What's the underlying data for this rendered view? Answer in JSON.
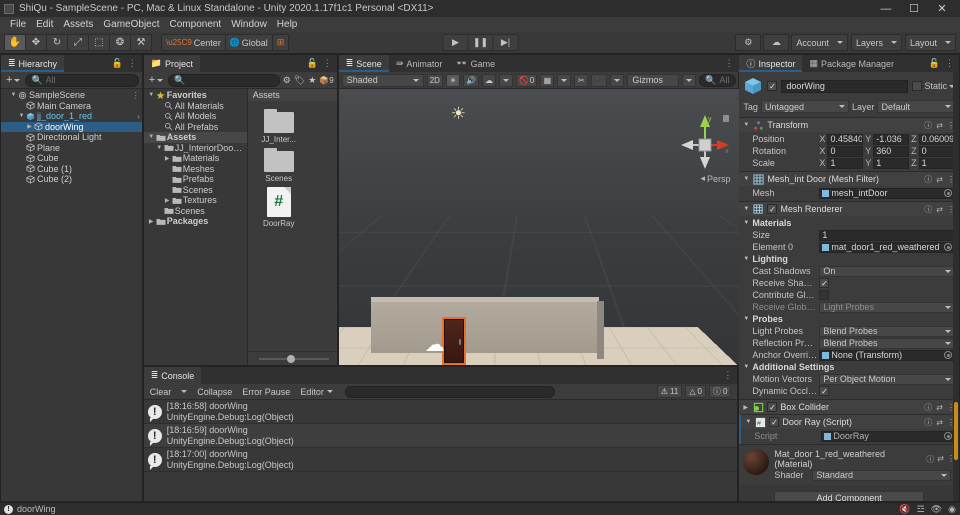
{
  "window": {
    "title": "ShiQu - SampleScene - PC, Mac & Linux Standalone - Unity 2020.1.17f1c1 Personal <DX11>",
    "minimize": "—",
    "maximize": "☐",
    "close": "✕"
  },
  "menu": {
    "items": [
      "File",
      "Edit",
      "Assets",
      "GameObject",
      "Component",
      "Window",
      "Help"
    ]
  },
  "toolbar": {
    "tools": [
      {
        "name": "hand-tool",
        "glyph": "✋",
        "active": true
      },
      {
        "name": "move-tool",
        "glyph": "✥",
        "active": false
      },
      {
        "name": "rotate-tool",
        "glyph": "↻",
        "active": false
      },
      {
        "name": "scale-tool",
        "glyph": "⤢",
        "active": false
      },
      {
        "name": "rect-tool",
        "glyph": "⬚",
        "active": false
      },
      {
        "name": "transform-tool",
        "glyph": "❂",
        "active": false
      },
      {
        "name": "custom-tool",
        "glyph": "⚒",
        "active": false
      }
    ],
    "pivot_label": "Center",
    "space_label": "Global",
    "grid_snap_glyph": "⊞",
    "play": "▶",
    "pause": "❚❚",
    "step": "▶|",
    "collab_label": "⚙",
    "cloud_label": "☁",
    "account_label": "Account",
    "layers_label": "Layers",
    "layout_label": "Layout"
  },
  "hierarchy": {
    "tab_label": "Hierarchy",
    "search_placeholder": "All",
    "add_label": "+",
    "items": [
      {
        "label": "SampleScene",
        "depth": 0,
        "arrow": "▼",
        "icon": "scene-icon",
        "selected": false,
        "menu": "⋮"
      },
      {
        "label": "Main Camera",
        "depth": 1,
        "arrow": "",
        "icon": "gameobject-icon",
        "selected": false
      },
      {
        "label": "jj_door_1_red",
        "depth": 1,
        "arrow": "▼",
        "icon": "prefab-icon",
        "selected": false,
        "chevron": "›"
      },
      {
        "label": "doorWing",
        "depth": 2,
        "arrow": "▶",
        "icon": "gameobject-icon",
        "selected": true
      },
      {
        "label": "Directional Light",
        "depth": 1,
        "arrow": "",
        "icon": "gameobject-icon",
        "selected": false
      },
      {
        "label": "Plane",
        "depth": 1,
        "arrow": "",
        "icon": "gameobject-icon",
        "selected": false
      },
      {
        "label": "Cube",
        "depth": 1,
        "arrow": "",
        "icon": "gameobject-icon",
        "selected": false
      },
      {
        "label": "Cube (1)",
        "depth": 1,
        "arrow": "",
        "icon": "gameobject-icon",
        "selected": false
      },
      {
        "label": "Cube (2)",
        "depth": 1,
        "arrow": "",
        "icon": "gameobject-icon",
        "selected": false
      }
    ]
  },
  "project": {
    "tab_label": "Project",
    "search_placeholder": "",
    "badge_count": "9",
    "tree": [
      {
        "label": "Favorites",
        "depth": 0,
        "arrow": "▼",
        "icon": "star-icon"
      },
      {
        "label": "All Materials",
        "depth": 1,
        "arrow": "",
        "icon": "search-icon"
      },
      {
        "label": "All Models",
        "depth": 1,
        "arrow": "",
        "icon": "search-icon"
      },
      {
        "label": "All Prefabs",
        "depth": 1,
        "arrow": "",
        "icon": "search-icon"
      },
      {
        "label": "Assets",
        "depth": 0,
        "arrow": "▼",
        "icon": "folder-icon",
        "highlighted": true
      },
      {
        "label": "JJ_InteriorDoorPack_",
        "depth": 1,
        "arrow": "▼",
        "icon": "folder-icon"
      },
      {
        "label": "Materials",
        "depth": 2,
        "arrow": "▶",
        "icon": "folder-icon"
      },
      {
        "label": "Meshes",
        "depth": 2,
        "arrow": "",
        "icon": "folder-icon"
      },
      {
        "label": "Prefabs",
        "depth": 2,
        "arrow": "",
        "icon": "folder-icon"
      },
      {
        "label": "Scenes",
        "depth": 2,
        "arrow": "",
        "icon": "folder-icon"
      },
      {
        "label": "Textures",
        "depth": 2,
        "arrow": "▶",
        "icon": "folder-icon"
      },
      {
        "label": "Scenes",
        "depth": 1,
        "arrow": "",
        "icon": "folder-icon"
      },
      {
        "label": "Packages",
        "depth": 0,
        "arrow": "▶",
        "icon": "folder-icon"
      }
    ],
    "grid_header": "Assets",
    "assets": [
      {
        "label": "JJ_Inter...",
        "type": "folder"
      },
      {
        "label": "Scenes",
        "type": "folder"
      },
      {
        "label": "DoorRay",
        "type": "csharp-script"
      }
    ]
  },
  "scene": {
    "tabs": [
      {
        "label": "Scene",
        "icon": "scene-icon",
        "selected": true
      },
      {
        "label": "Animator",
        "icon": "animator-icon",
        "selected": false
      },
      {
        "label": "Game",
        "icon": "game-icon",
        "selected": false
      }
    ],
    "shading_mode": "Shaded",
    "mode_2d": "2D",
    "lighting_glyph": "☀",
    "audio_glyph": "ᴘ",
    "fx_glyph": "☁",
    "hidden_count": "0",
    "gizmos_label": "Gizmos",
    "search_placeholder": "All",
    "projection_label": "Persp",
    "gizmo_axis_x": "x",
    "gizmo_axis_y": "y"
  },
  "console": {
    "tab_label": "Console",
    "clear_label": "Clear",
    "collapse_label": "Collapse",
    "error_pause_label": "Error Pause",
    "editor_label": "Editor",
    "error_count": "11",
    "warning_count": "0",
    "info_count": "0",
    "logs": [
      {
        "line1": "[18:16:58] doorWing",
        "line2": "UnityEngine.Debug:Log(Object)"
      },
      {
        "line1": "[18:16:59] doorWing",
        "line2": "UnityEngine.Debug:Log(Object)"
      },
      {
        "line1": "[18:17:00] doorWing",
        "line2": "UnityEngine.Debug:Log(Object)"
      }
    ]
  },
  "inspector": {
    "tabs": [
      {
        "label": "Inspector",
        "icon": "info-icon",
        "selected": true
      },
      {
        "label": "Package Manager",
        "icon": "package-icon",
        "selected": false
      }
    ],
    "gameobject": {
      "name": "doorWing",
      "enabled": true,
      "static_label": "Static",
      "tag_label": "Tag",
      "tag_value": "Untagged",
      "layer_label": "Layer",
      "layer_value": "Default"
    },
    "components": [
      {
        "title": "Transform",
        "icon": "transform-icon",
        "rows": [
          {
            "label": "Position",
            "type": "vec3",
            "x": "0.45840",
            "y": "-1.036",
            "z": "0.060098"
          },
          {
            "label": "Rotation",
            "type": "vec3",
            "x": "0",
            "y": "360",
            "z": "0"
          },
          {
            "label": "Scale",
            "type": "vec3",
            "x": "1",
            "y": "1",
            "z": "1"
          }
        ]
      },
      {
        "title": "Mesh_int Door (Mesh Filter)",
        "icon": "meshfilter-icon",
        "rows": [
          {
            "label": "Mesh",
            "type": "object",
            "value": "mesh_intDoor"
          }
        ]
      },
      {
        "title": "Mesh Renderer",
        "icon": "meshrenderer-icon",
        "checkbox": true,
        "rows": [
          {
            "label": "Materials",
            "type": "section"
          },
          {
            "label": "Size",
            "type": "text",
            "value": "1"
          },
          {
            "label": "Element 0",
            "type": "object",
            "value": "mat_door1_red_weathered"
          },
          {
            "label": "Lighting",
            "type": "section"
          },
          {
            "label": "Cast Shadows",
            "type": "select",
            "value": "On"
          },
          {
            "label": "Receive Shadows",
            "type": "check",
            "value": true
          },
          {
            "label": "Contribute Global",
            "type": "check",
            "value": false
          },
          {
            "label": "Receive Global Illu",
            "type": "select",
            "value": "Light Probes",
            "dim": true
          },
          {
            "label": "Probes",
            "type": "section"
          },
          {
            "label": "Light Probes",
            "type": "select",
            "value": "Blend Probes"
          },
          {
            "label": "Reflection Probes",
            "type": "select",
            "value": "Blend Probes"
          },
          {
            "label": "Anchor Override",
            "type": "object",
            "value": "None (Transform)"
          },
          {
            "label": "Additional Settings",
            "type": "section"
          },
          {
            "label": "Motion Vectors",
            "type": "select",
            "value": "Per Object Motion"
          },
          {
            "label": "Dynamic Occlusio",
            "type": "check",
            "value": true
          }
        ]
      },
      {
        "title": "Box Collider",
        "icon": "collider-icon",
        "checkbox": true,
        "collapsed": true,
        "rows": []
      },
      {
        "title": "Door Ray (Script)",
        "icon": "script-icon",
        "checkbox": true,
        "rows": [
          {
            "label": "Script",
            "type": "object",
            "value": "DoorRay",
            "dim": true
          }
        ]
      }
    ],
    "material": {
      "name": "Mat_door 1_red_weathered (Material)",
      "shader_label": "Shader",
      "shader_value": "Standard"
    },
    "add_component_label": "Add Component"
  },
  "statusbar": {
    "message": "doorWing",
    "icons": [
      "mute-icon",
      "layers-icon",
      "visibility-icon",
      "target-icon"
    ]
  }
}
